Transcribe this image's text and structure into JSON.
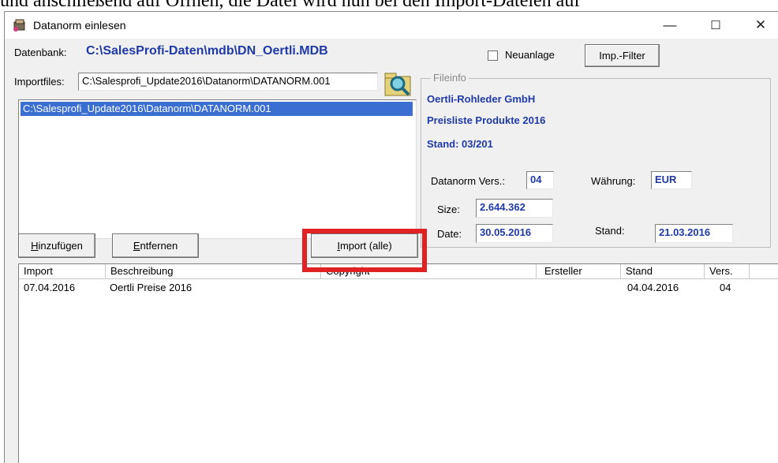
{
  "document_text": "und anschließend auf Öffnen, die Datei wird nun bei den Import-Dateien auf",
  "window": {
    "title": "Datanorm einlesen",
    "minimize_glyph": "—",
    "maximize_glyph": "☐",
    "close_glyph": "✕"
  },
  "database": {
    "label": "Datenbank:",
    "path": "C:\\SalesProfi-Daten\\mdb\\DN_Oertli.MDB"
  },
  "neuanlage": {
    "label": "Neuanlage",
    "checked": false
  },
  "imp_filter_button": "Imp.-Filter",
  "importfiles": {
    "label": "Importfiles:",
    "value": "C:\\Salesprofi_Update2016\\Datanorm\\DATANORM.001",
    "browse_icon": "magnifier-folder-icon",
    "list_items": [
      "C:\\Salesprofi_Update2016\\Datanorm\\DATANORM.001"
    ]
  },
  "fileinfo": {
    "legend": "Fileinfo",
    "company": "Oertli-Rohleder GmbH",
    "description": "Preisliste Produkte 2016",
    "stand_text": "Stand: 03/201",
    "datanorm_vers_label": "Datanorm Vers.:",
    "datanorm_vers": "04",
    "waehrung_label": "Währung:",
    "waehrung": "EUR",
    "size_label": "Size:",
    "size": "2.644.362",
    "date_label": "Date:",
    "date": "30.05.2016",
    "stand_label": "Stand:",
    "stand": "21.03.2016"
  },
  "buttons": {
    "hinzufuegen_u": "H",
    "hinzufuegen_rest": "inzufügen",
    "entfernen_u": "E",
    "entfernen_rest": "ntfernen",
    "import_u": "I",
    "import_rest": "mport (alle)"
  },
  "table": {
    "columns": [
      "Import",
      "Beschreibung",
      "Copyright",
      "Ersteller",
      "Stand",
      "Vers."
    ],
    "rows": [
      {
        "import": "07.04.2016",
        "beschreibung": "Oertli Preise 2016",
        "copyright": "",
        "ersteller": "",
        "stand": "04.04.2016",
        "vers": "04"
      }
    ]
  },
  "colors": {
    "highlight": "#e02222",
    "accent_text": "#1f3aa8",
    "selection": "#3a6fd1"
  }
}
